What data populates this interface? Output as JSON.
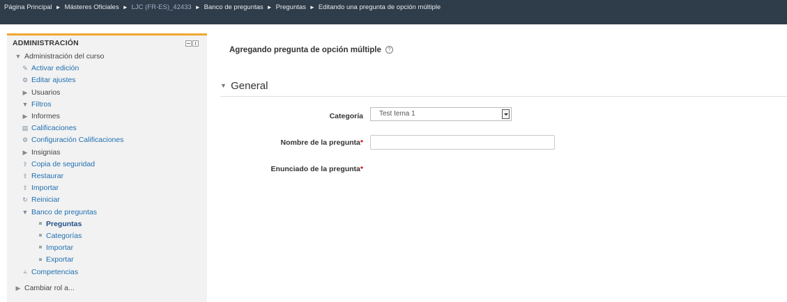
{
  "breadcrumb": {
    "items": [
      {
        "label": "Página Principal",
        "kind": "item"
      },
      {
        "label": "Másteres Oficiales",
        "kind": "item"
      },
      {
        "label": "LJC (FR-ES)_42433",
        "kind": "course"
      },
      {
        "label": "Banco de preguntas",
        "kind": "item"
      },
      {
        "label": "Preguntas",
        "kind": "item"
      },
      {
        "label": "Editando una pregunta de opción múltiple",
        "kind": "item"
      }
    ],
    "separator": "►"
  },
  "sidebar": {
    "title": "ADMINISTRACIÓN",
    "nodes": [
      {
        "label": "Administración del curso",
        "icon": "▼",
        "icon_name": "expanded-caret-icon",
        "level": 0,
        "style": "dark"
      },
      {
        "label": "Activar edición",
        "icon": "✎",
        "icon_name": "pencil-icon",
        "level": 1,
        "style": "link"
      },
      {
        "label": "Editar ajustes",
        "icon": "⚙",
        "icon_name": "gear-icon",
        "level": 1,
        "style": "link"
      },
      {
        "label": "Usuarios",
        "icon": "▶",
        "icon_name": "collapsed-caret-icon",
        "level": 1,
        "style": "dark"
      },
      {
        "label": "Filtros",
        "icon": "▼",
        "icon_name": "filter-icon",
        "level": 1,
        "style": "link"
      },
      {
        "label": "Informes",
        "icon": "▶",
        "icon_name": "collapsed-caret-icon",
        "level": 1,
        "style": "dark"
      },
      {
        "label": "Calificaciones",
        "icon": "▤",
        "icon_name": "grades-table-icon",
        "level": 1,
        "style": "link"
      },
      {
        "label": "Configuración Calificaciones",
        "icon": "⚙",
        "icon_name": "gear-icon",
        "level": 1,
        "style": "link"
      },
      {
        "label": "Insignias",
        "icon": "▶",
        "icon_name": "collapsed-caret-icon",
        "level": 1,
        "style": "dark"
      },
      {
        "label": "Copia de seguridad",
        "icon": "⇧",
        "icon_name": "backup-icon",
        "level": 1,
        "style": "link"
      },
      {
        "label": "Restaurar",
        "icon": "⇧",
        "icon_name": "restore-icon",
        "level": 1,
        "style": "link"
      },
      {
        "label": "Importar",
        "icon": "⇧",
        "icon_name": "import-icon",
        "level": 1,
        "style": "link"
      },
      {
        "label": "Reiniciar",
        "icon": "↻",
        "icon_name": "reset-icon",
        "level": 1,
        "style": "link"
      },
      {
        "label": "Banco de preguntas",
        "icon": "▼",
        "icon_name": "expanded-caret-icon",
        "level": 1,
        "style": "link"
      },
      {
        "label": "Preguntas",
        "icon": "",
        "icon_name": "bullet-icon",
        "level": 2,
        "style": "bold"
      },
      {
        "label": "Categorías",
        "icon": "",
        "icon_name": "bullet-icon",
        "level": 2,
        "style": "link"
      },
      {
        "label": "Importar",
        "icon": "",
        "icon_name": "bullet-icon",
        "level": 2,
        "style": "link"
      },
      {
        "label": "Exportar",
        "icon": "",
        "icon_name": "bullet-icon",
        "level": 2,
        "style": "link"
      },
      {
        "label": "Competencias",
        "icon": "⩮",
        "icon_name": "competencies-icon",
        "level": 1,
        "style": "link"
      },
      {
        "label": "Cambiar rol a...",
        "icon": "▶",
        "icon_name": "collapsed-caret-icon",
        "level": 0,
        "style": "dark"
      }
    ]
  },
  "main": {
    "heading": "Agregando pregunta de opción múltiple",
    "help_glyph": "?",
    "section_title": "General",
    "section_caret": "▼",
    "fields": {
      "category_label": "Categoría",
      "category_value": "Test tema 1",
      "name_label": "Nombre de la pregunta",
      "name_value": "",
      "statement_label": "Enunciado de la pregunta",
      "required_mark": "*"
    }
  },
  "colors": {
    "topbar": "#2f3c49",
    "block_accent": "#f0a72c",
    "link": "#1f6fb0",
    "required": "#cc0000"
  }
}
